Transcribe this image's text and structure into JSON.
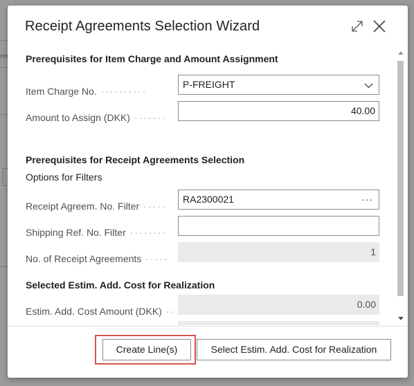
{
  "background_app": {
    "stub_text": "rec"
  },
  "dialog": {
    "title": "Receipt Agreements Selection Wizard",
    "icons": {
      "expand": "expand-icon",
      "close": "close-icon"
    }
  },
  "sections": {
    "prereq_item_charge": {
      "heading": "Prerequisites for Item Charge and Amount Assignment",
      "item_charge_no": {
        "label": "Item Charge No.",
        "value": "P-FREIGHT"
      },
      "amount_to_assign": {
        "label": "Amount to Assign (DKK)",
        "value": "40.00"
      }
    },
    "prereq_receipt_agreements": {
      "heading": "Prerequisites for Receipt Agreements Selection",
      "subheading": "Options for Filters",
      "receipt_agreem_no_filter": {
        "label": "Receipt Agreem. No. Filter",
        "value": "RA2300021",
        "lookup": "···"
      },
      "shipping_ref_no_filter": {
        "label": "Shipping Ref. No. Filter",
        "value": ""
      },
      "no_of_receipt_agreements": {
        "label": "No. of Receipt Agreements",
        "value": "1"
      }
    },
    "selected_estim": {
      "heading": "Selected Estim. Add. Cost for Realization",
      "estim_add_cost_amount": {
        "label": "Estim. Add. Cost Amount (DKK)",
        "value": "0.00"
      }
    }
  },
  "footer": {
    "create_lines_label": "Create Line(s)",
    "select_estim_label": "Select Estim. Add. Cost for Realization"
  },
  "colors": {
    "highlight": "#d9534f",
    "readonly_bg": "#eaeaea"
  }
}
